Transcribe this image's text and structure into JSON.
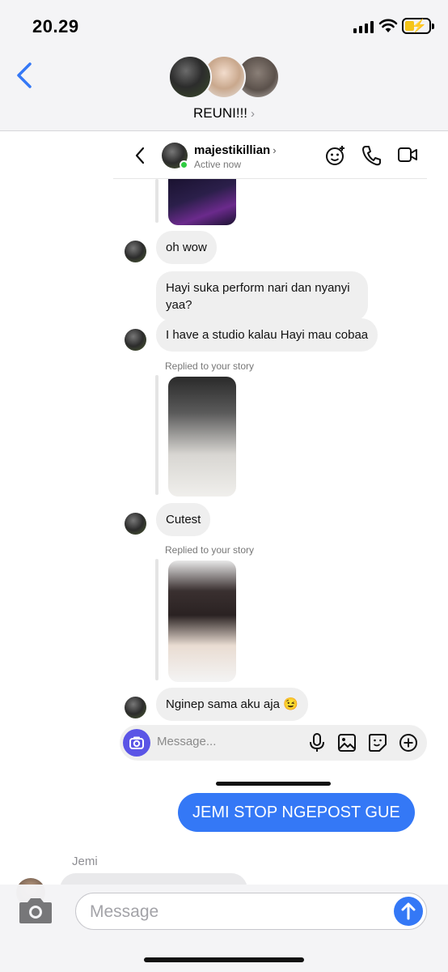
{
  "status_bar": {
    "time": "20.29"
  },
  "header": {
    "group_name": "REUNI!!!"
  },
  "embedded": {
    "ig_header": {
      "username": "majestikillian",
      "status": "Active now"
    },
    "messages": [
      {
        "text": "oh wow"
      },
      {
        "text": "Hayi suka perform nari dan nyanyi yaa?"
      },
      {
        "text": "I have a studio kalau Hayi mau cobaa"
      },
      {
        "text": "Cutest"
      },
      {
        "text": "Nginep sama aku aja 😉"
      }
    ],
    "replied_labels": [
      "Replied to your story",
      "Replied to your story"
    ],
    "input_placeholder": "Message..."
  },
  "conversation": {
    "sent_message": "JEMI STOP NGEPOST GUE",
    "sender_name": "Jemi"
  },
  "compose": {
    "placeholder": "Message"
  },
  "colors": {
    "imessage_blue": "#3478f6",
    "ig_purple": "#5b55e6",
    "online_green": "#2ecc40"
  }
}
